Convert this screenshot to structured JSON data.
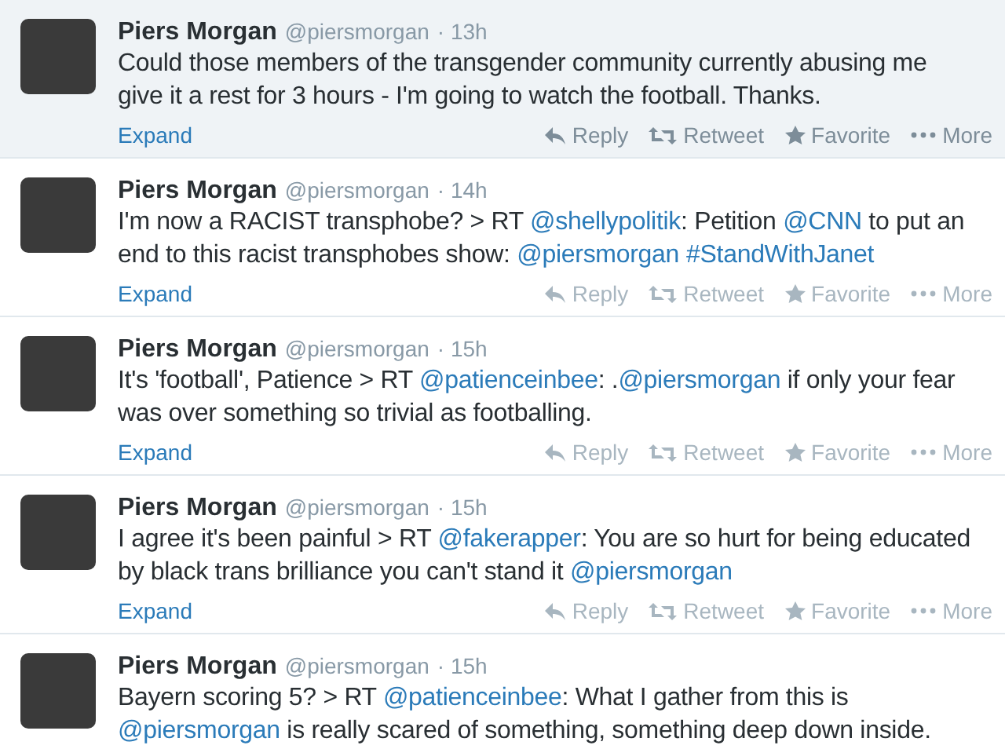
{
  "tweets": [
    {
      "name": "Piers Morgan",
      "handle": "@piersmorgan",
      "time": "· 13h",
      "highlighted": true,
      "lines": [
        [
          {
            "kind": "plain",
            "text": "Could those members of the transgender community currently abusing me"
          }
        ],
        [
          {
            "kind": "plain",
            "text": "give it a rest for 3 hours - I'm going to watch the football. Thanks."
          }
        ]
      ],
      "expand": "Expand",
      "actions": [
        "Reply",
        "Retweet",
        "Favorite",
        "More"
      ]
    },
    {
      "name": "Piers Morgan",
      "handle": "@piersmorgan",
      "time": "· 14h",
      "highlighted": false,
      "lines": [
        [
          {
            "kind": "plain",
            "text": "I'm now a RACIST transphobe? > RT "
          },
          {
            "kind": "link",
            "text": "@shellypolitik"
          },
          {
            "kind": "plain",
            "text": ": Petition "
          },
          {
            "kind": "link",
            "text": "@CNN"
          },
          {
            "kind": "plain",
            "text": " to put an"
          }
        ],
        [
          {
            "kind": "plain",
            "text": "end to this racist transphobes show: "
          },
          {
            "kind": "link",
            "text": "@piersmorgan"
          },
          {
            "kind": "link",
            "text": "#StandWithJanet"
          }
        ]
      ],
      "expand": "Expand",
      "actions": [
        "Reply",
        "Retweet",
        "Favorite",
        "More"
      ]
    },
    {
      "name": "Piers Morgan",
      "handle": "@piersmorgan",
      "time": "· 15h",
      "highlighted": false,
      "lines": [
        [
          {
            "kind": "plain",
            "text": "It's 'football', Patience > RT  "
          },
          {
            "kind": "link",
            "text": "@patienceinbee"
          },
          {
            "kind": "plain",
            "text": ": ."
          },
          {
            "kind": "link",
            "text": "@piersmorgan"
          },
          {
            "kind": "plain",
            "text": " if only your fear"
          }
        ],
        [
          {
            "kind": "plain",
            "text": "was over something so trivial as footballing."
          }
        ]
      ],
      "expand": "Expand",
      "actions": [
        "Reply",
        "Retweet",
        "Favorite",
        "More"
      ]
    },
    {
      "name": "Piers Morgan",
      "handle": "@piersmorgan",
      "time": "· 15h",
      "highlighted": false,
      "lines": [
        [
          {
            "kind": "plain",
            "text": "I agree it's been painful > RT "
          },
          {
            "kind": "link",
            "text": "@fakerapper"
          },
          {
            "kind": "plain",
            "text": ": You are so hurt for being educated"
          }
        ],
        [
          {
            "kind": "plain",
            "text": "by black trans brilliance you can't stand it "
          },
          {
            "kind": "link",
            "text": "@piersmorgan"
          }
        ]
      ],
      "expand": "Expand",
      "actions": [
        "Reply",
        "Retweet",
        "Favorite",
        "More"
      ]
    },
    {
      "name": "Piers Morgan",
      "handle": "@piersmorgan",
      "time": "· 15h",
      "highlighted": false,
      "lines": [
        [
          {
            "kind": "plain",
            "text": "Bayern scoring 5? > RT "
          },
          {
            "kind": "link",
            "text": "@patienceinbee"
          },
          {
            "kind": "plain",
            "text": ": What I gather from this is"
          }
        ],
        [
          {
            "kind": "link",
            "text": "@piersmorgan"
          },
          {
            "kind": "plain",
            "text": " is really scared of something, something deep down inside."
          }
        ]
      ]
    }
  ]
}
